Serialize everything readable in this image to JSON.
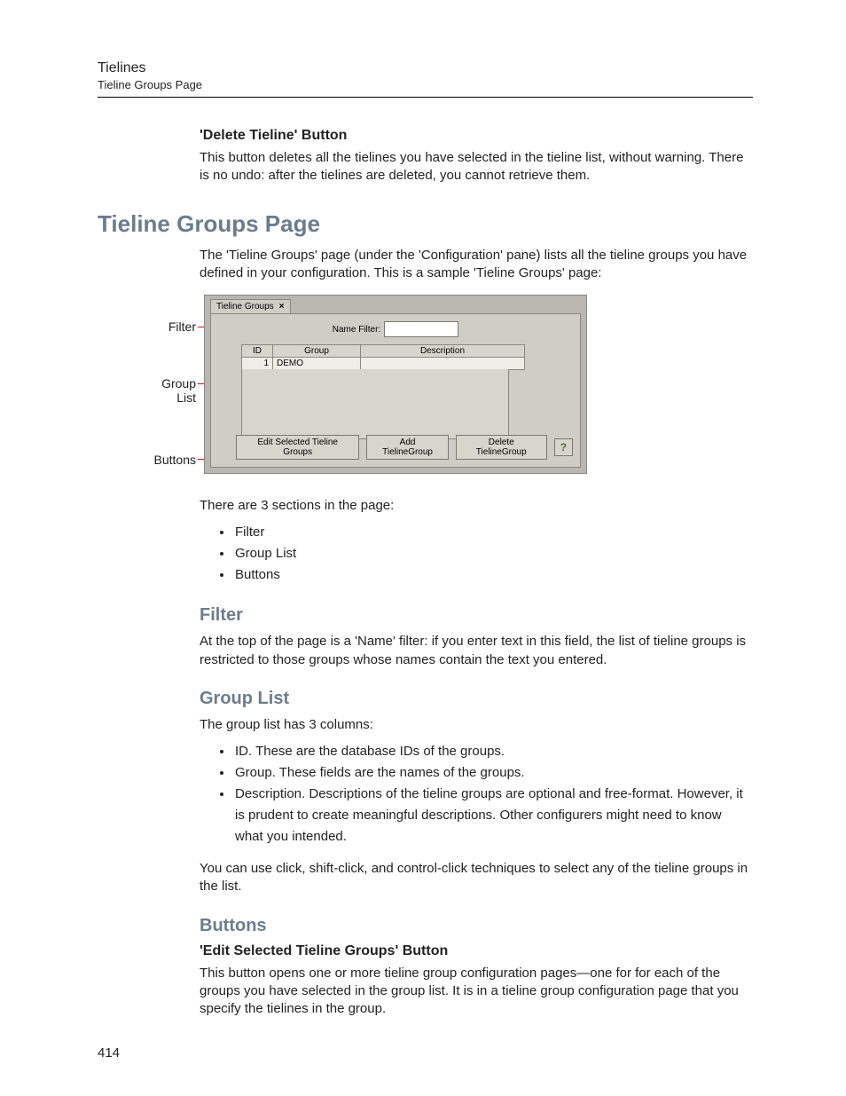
{
  "header": {
    "chapter": "Tielines",
    "section": "Tieline Groups Page"
  },
  "delete_btn": {
    "heading": "'Delete Tieline' Button",
    "para": "This button deletes all the tielines you have selected in the tieline list, without warning. There is no undo: after the tielines are deleted, you cannot retrieve them."
  },
  "main_heading": "Tieline Groups Page",
  "intro": "The 'Tieline Groups' page (under the 'Configuration' pane) lists all the tieline groups you have defined in your configuration. This is a sample 'Tieline Groups' page:",
  "screenshot": {
    "tab_label": "Tieline Groups",
    "filter_label": "Name Filter:",
    "columns": {
      "id": "ID",
      "group": "Group",
      "description": "Description"
    },
    "row": {
      "id": "1",
      "group": "DEMO",
      "description": ""
    },
    "buttons": {
      "edit": "Edit Selected Tieline Groups",
      "add": "Add TielineGroup",
      "del": "Delete TielineGroup"
    },
    "callouts": {
      "filter": "Filter",
      "group_list1": "Group",
      "group_list2": "List",
      "buttons": "Buttons"
    }
  },
  "after_shot": "There are 3 sections in the page:",
  "sections_list": {
    "a": "Filter",
    "b": "Group List",
    "c": "Buttons"
  },
  "filter": {
    "heading": "Filter",
    "para": "At the top of the page is a 'Name' filter: if you enter text in this field, the list of tieline groups is restricted to those groups whose names contain the text you entered."
  },
  "group_list": {
    "heading": "Group List",
    "intro": "The group list has 3 columns:",
    "items": {
      "a": "ID. These are the database IDs of the groups.",
      "b": "Group. These fields are the names of the groups.",
      "c": "Description. Descriptions of the tieline groups are optional and free-format. However, it is prudent to create meaningful descriptions. Other configurers might need to know what you intended."
    },
    "outro": "You can use click, shift-click, and control-click techniques to select any of the tieline groups in the list."
  },
  "buttons_section": {
    "heading": "Buttons",
    "sub_heading": "'Edit Selected Tieline Groups' Button",
    "para": "This button opens one or more tieline group configuration pages—one for for each of the groups you have selected in the group list. It is in a tieline group configuration page that you specify the tielines in the group."
  },
  "page_number": "414"
}
